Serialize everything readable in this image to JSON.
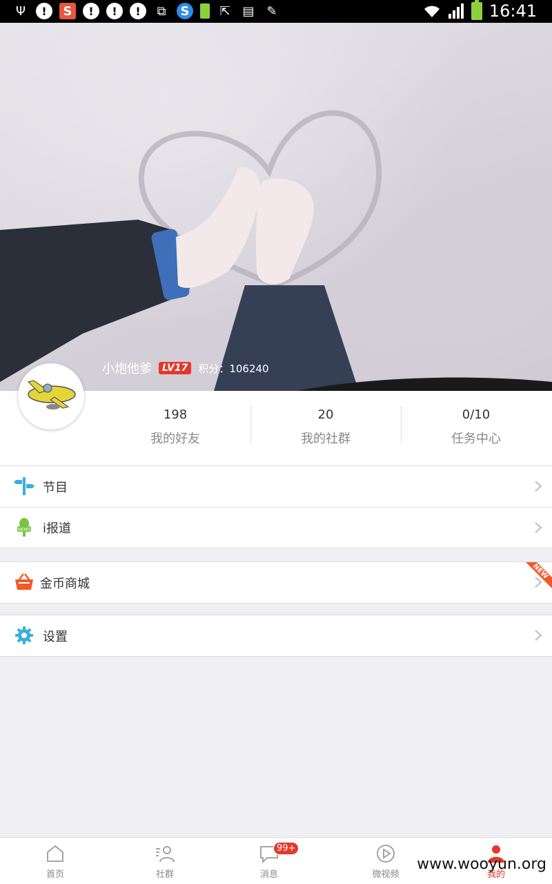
{
  "status_bar": {
    "time": "16:41",
    "left_icons": [
      "usb-icon",
      "alert-icon",
      "sogou-icon",
      "alert-icon",
      "alert-icon",
      "alert-icon",
      "plugin-icon",
      "browser-360-icon",
      "battery-small-icon",
      "screen-share-icon",
      "sim-icon",
      "pen-icon"
    ]
  },
  "profile": {
    "username": "小炮他爹",
    "level": "LV17",
    "score_label": "积分：",
    "score_value": "106240",
    "stats": [
      {
        "value": "198",
        "label": "我的好友"
      },
      {
        "value": "20",
        "label": "我的社群"
      },
      {
        "value": "0/10",
        "label": "任务中心"
      }
    ]
  },
  "menu": {
    "group1": [
      {
        "label": "节目",
        "icon": "signpost-icon"
      },
      {
        "label": "i报道",
        "icon": "news-mic-icon"
      }
    ],
    "group2": [
      {
        "label": "金币商城",
        "icon": "basket-icon",
        "badge": "NEW"
      }
    ],
    "group3": [
      {
        "label": "设置",
        "icon": "gear-icon"
      }
    ]
  },
  "tabbar": {
    "tabs": [
      {
        "label": "首页",
        "icon": "home-icon"
      },
      {
        "label": "社群",
        "icon": "community-icon"
      },
      {
        "label": "消息",
        "icon": "message-icon",
        "badge": "99+"
      },
      {
        "label": "微视频",
        "icon": "video-icon"
      },
      {
        "label": "我的",
        "icon": "profile-icon",
        "active": true
      }
    ]
  },
  "watermark": "www.wooyun.org",
  "colors": {
    "accent": "#e5372c",
    "blue_icon": "#3aaee0",
    "green_icon": "#7cc242",
    "orange_icon": "#f05a28"
  }
}
